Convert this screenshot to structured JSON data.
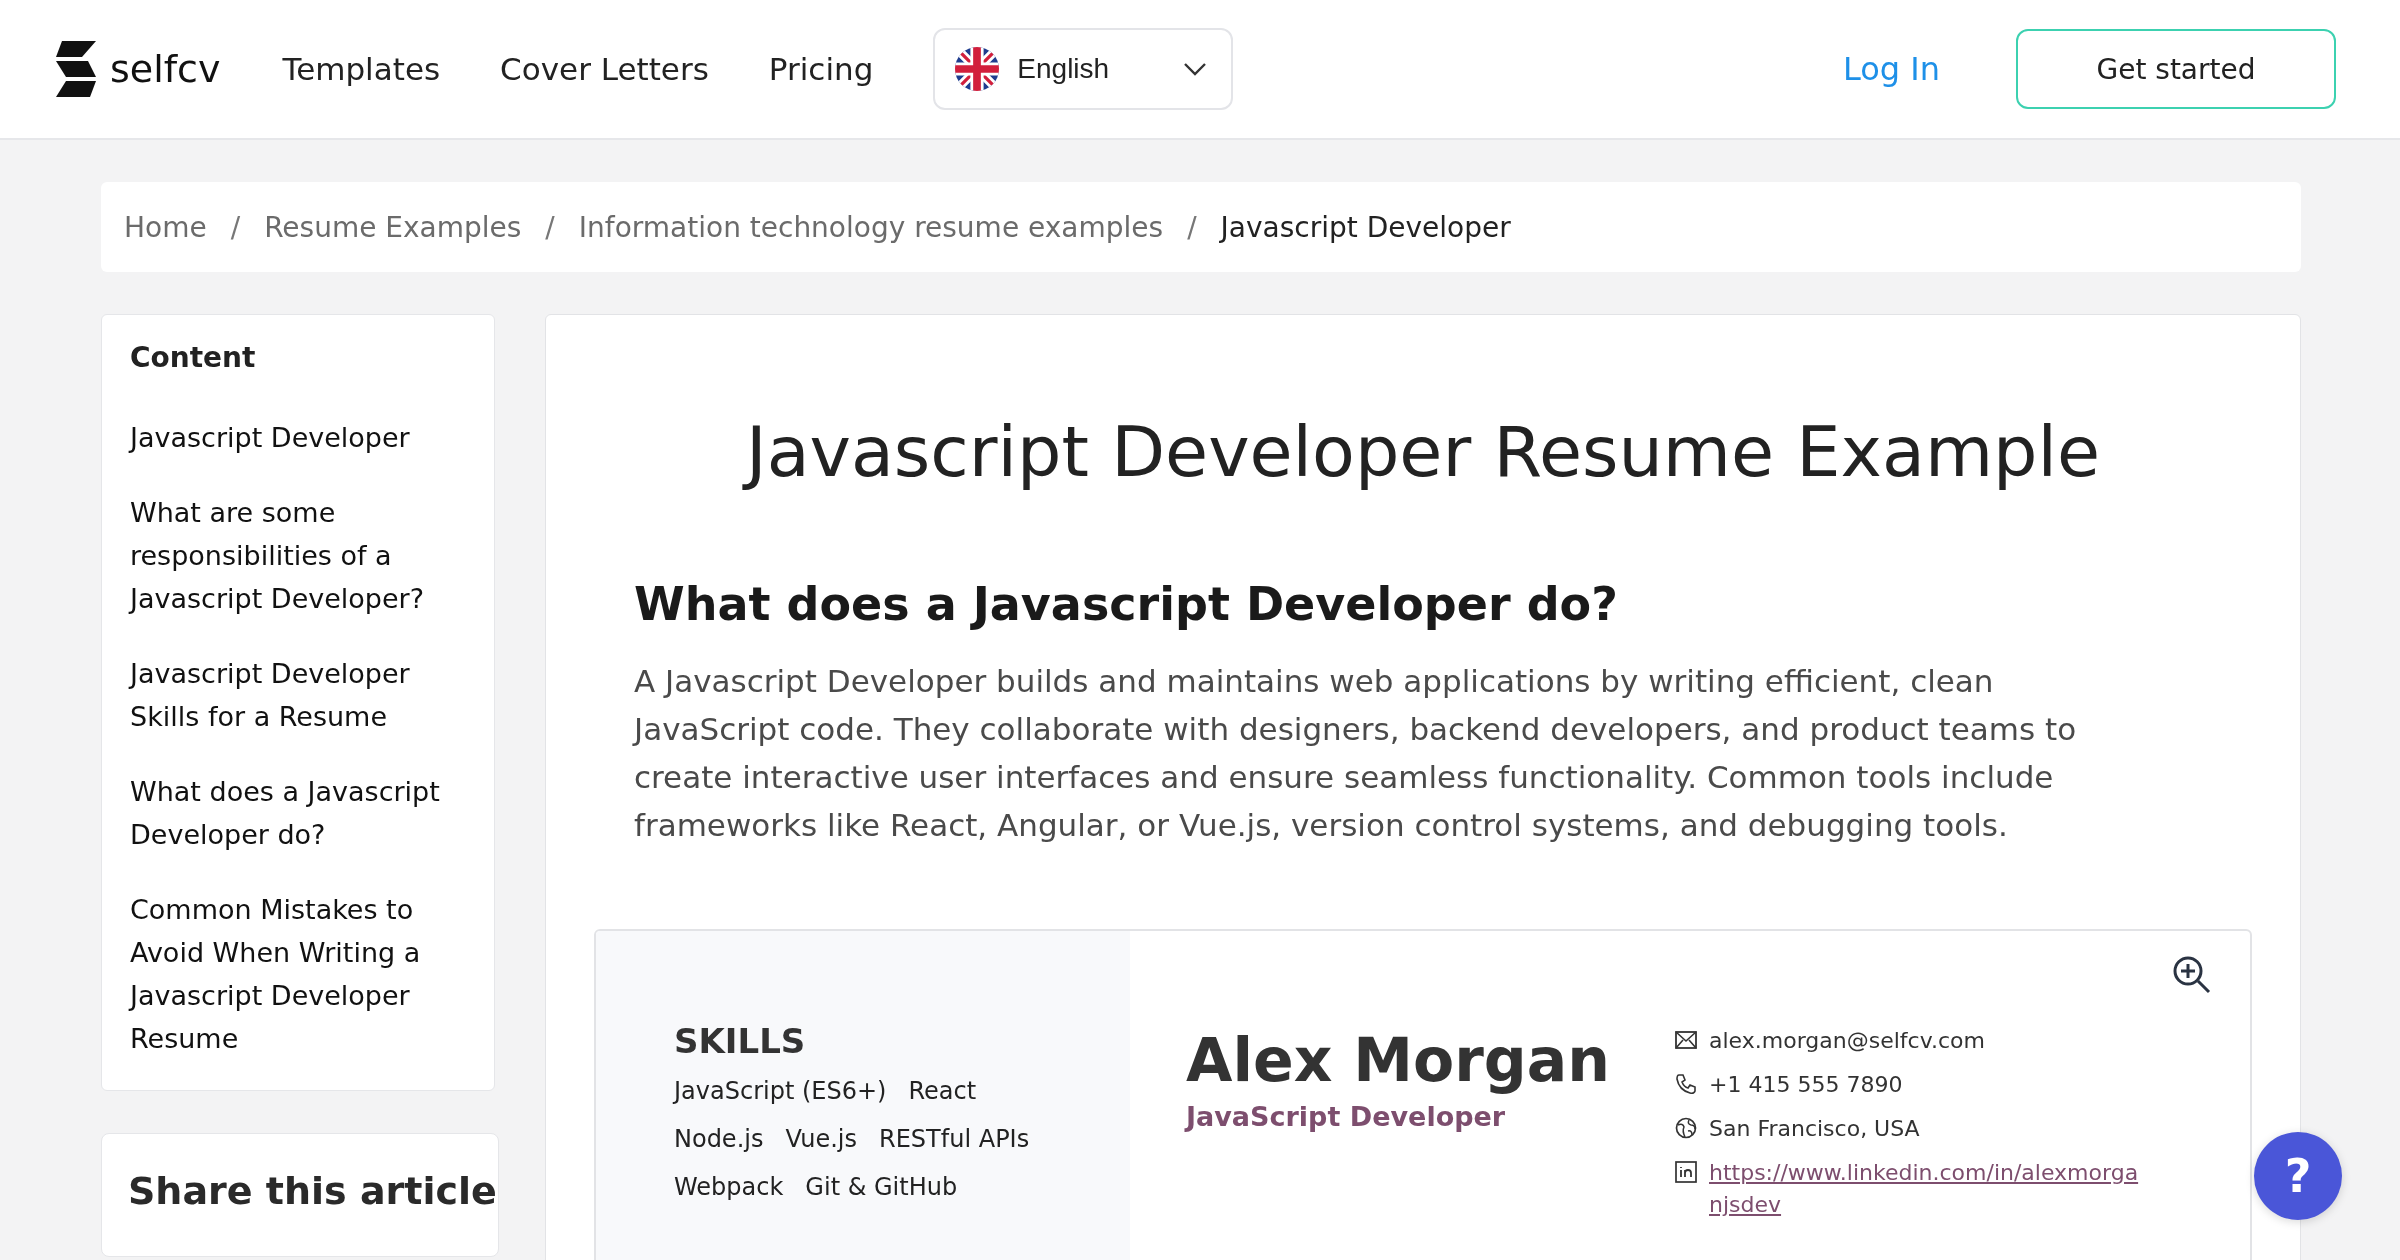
{
  "header": {
    "logo": "selfcv",
    "nav": [
      "Templates",
      "Cover Letters",
      "Pricing"
    ],
    "language": {
      "value": "English"
    },
    "login": "Log In",
    "cta": "Get started"
  },
  "breadcrumb": {
    "separator": "/",
    "items": [
      {
        "label": "Home",
        "selected": false
      },
      {
        "label": "Resume Examples",
        "selected": false
      },
      {
        "label": "Information technology resume examples",
        "selected": false
      },
      {
        "label": "Javascript Developer",
        "selected": true
      }
    ]
  },
  "sidebar": {
    "title": "Content",
    "items": [
      "Javascript Developer",
      "What are some responsibilities of a Javascript Developer?",
      "Javascript Developer Skills for a Resume",
      "What does a Javascript Developer do?",
      "Common Mistakes to Avoid When Writing a Javascript Developer Resume"
    ],
    "share_title": "Share this article"
  },
  "article": {
    "title": "Javascript Developer Resume Example",
    "heading": "What does a Javascript Developer do?",
    "paragraph": "A Javascript Developer builds and maintains web applications by writing efficient, clean JavaScript code. They collaborate with designers, backend developers, and product teams to create interactive user interfaces and ensure seamless functionality. Common tools include frameworks like React, Angular, or Vue.js, version control systems, and debugging tools."
  },
  "resume": {
    "skills_title": "SKILLS",
    "skills": [
      [
        "JavaScript (ES6+)",
        "React"
      ],
      [
        "Node.js",
        "Vue.js",
        "RESTful APIs"
      ],
      [
        "Webpack",
        "Git & GitHub"
      ]
    ],
    "name": "Alex Morgan",
    "role": "JavaScript Developer",
    "contacts": [
      {
        "kind": "email",
        "text": "alex.morgan@selfcv.com"
      },
      {
        "kind": "phone",
        "text": "+1 415 555 7890"
      },
      {
        "kind": "location",
        "text": "San Francisco, USA"
      },
      {
        "kind": "linkedin",
        "text": "https://www.linkedin.com/in/alexmorganjsdev"
      }
    ]
  },
  "help": "?"
}
